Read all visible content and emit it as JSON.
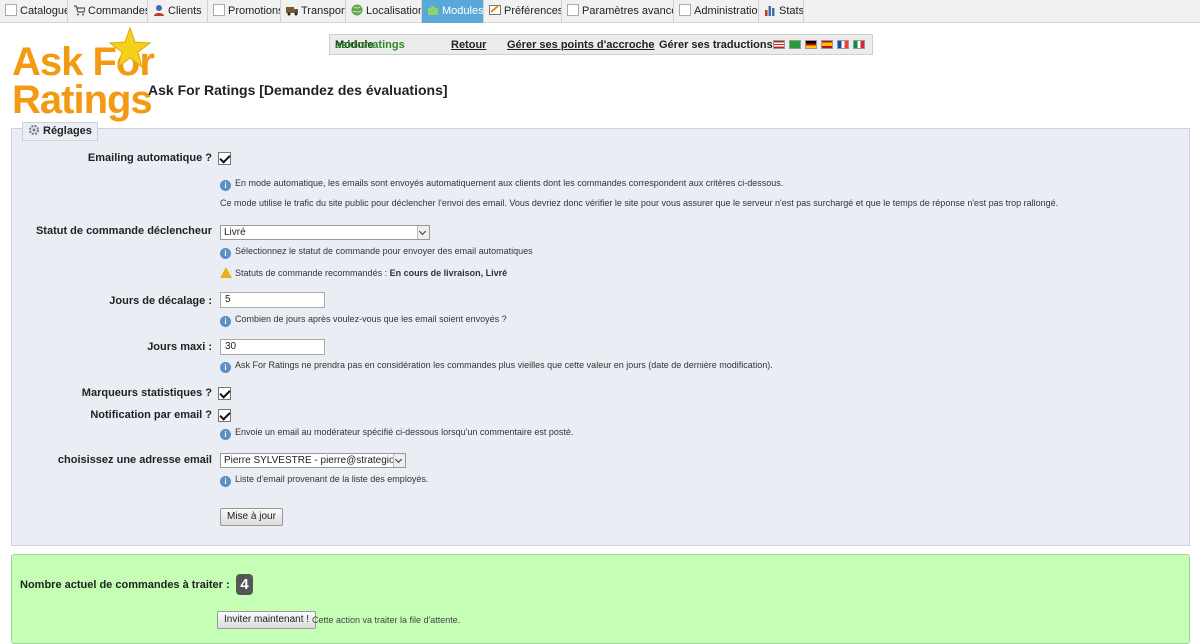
{
  "nav": {
    "tabs": [
      {
        "label": "Catalogue",
        "icon": "catalogue-icon"
      },
      {
        "label": "Commandes",
        "icon": "cart-icon"
      },
      {
        "label": "Clients",
        "icon": "clients-icon"
      },
      {
        "label": "Promotions",
        "icon": "promotions-icon"
      },
      {
        "label": "Transport",
        "icon": "truck-icon"
      },
      {
        "label": "Localisation",
        "icon": "globe-icon"
      },
      {
        "label": "Modules",
        "icon": "puzzle-icon",
        "active": true
      },
      {
        "label": "Préférences",
        "icon": "preferences-icon"
      },
      {
        "label": "Paramètres avancés",
        "icon": "advanced-icon"
      },
      {
        "label": "Administration",
        "icon": "admin-icon"
      },
      {
        "label": "Stats",
        "icon": "stats-icon"
      }
    ]
  },
  "modbar": {
    "module_prefix": "Module",
    "module_name": "askforratings",
    "back": "Retour",
    "hooks": "Gérer ses points d'accroche",
    "translations": "Gérer ses traductions :",
    "flags": [
      "en",
      "br",
      "de",
      "es",
      "fr",
      "it"
    ]
  },
  "logo": {
    "line1": "Ask For",
    "line2": "Ratings"
  },
  "page": {
    "title": "Ask For Ratings [Demandez des évaluations]"
  },
  "settings": {
    "legend": "Réglages",
    "auto_email": {
      "label": "Emailing automatique ?",
      "checked": true,
      "hint1": "En mode automatique, les emails sont envoyés automatiquement aux clients dont les commandes correspondent aux critères ci-dessous.",
      "hint2": "Ce mode utilise le trafic du site public pour déclencher l'envoi des email. Vous devriez donc vérifier le site pour vous assurer que le serveur n'est pas surchargé et que le temps de réponse n'est pas trop rallongé."
    },
    "trigger_status": {
      "label": "Statut de commande déclencheur",
      "value": "Livré",
      "hint": "Sélectionnez le statut de commande pour envoyer des email automatiques",
      "warn_prefix": "Statuts de commande recommandés : ",
      "warn_bold": "En cours de livraison, Livré"
    },
    "delay_days": {
      "label": "Jours de décalage :",
      "value": "5",
      "hint": "Combien de jours après voulez-vous que les email soient envoyés ?"
    },
    "max_days": {
      "label": "Jours maxi :",
      "value": "30",
      "hint": "Ask For Ratings ne prendra pas en considération les commandes plus vieilles que cette valeur en jours (date de dernière modification)."
    },
    "stats_markers": {
      "label": "Marqueurs statistiques ?",
      "checked": true
    },
    "email_notify": {
      "label": "Notification par email ?",
      "checked": true,
      "hint": "Envoie un email au modérateur spécifié ci-dessous lorsqu'un commentaire est posté."
    },
    "email_address": {
      "label": "choisissez une adresse email",
      "value": "Pierre SYLVESTRE - pierre@strategio.fr",
      "hint": "Liste d'email provenant de la liste des employés."
    },
    "update_button": "Mise à jour"
  },
  "queue": {
    "label": "Nombre actuel de commandes à traiter :",
    "count": "4",
    "button": "Inviter maintenant !",
    "note": "Cette action va traiter la file d'attente."
  },
  "colors": {
    "accent": "#5aa8d8",
    "logo": "#f39a13",
    "panel": "#ebedf4",
    "queue_bg": "#c4ffb5"
  }
}
